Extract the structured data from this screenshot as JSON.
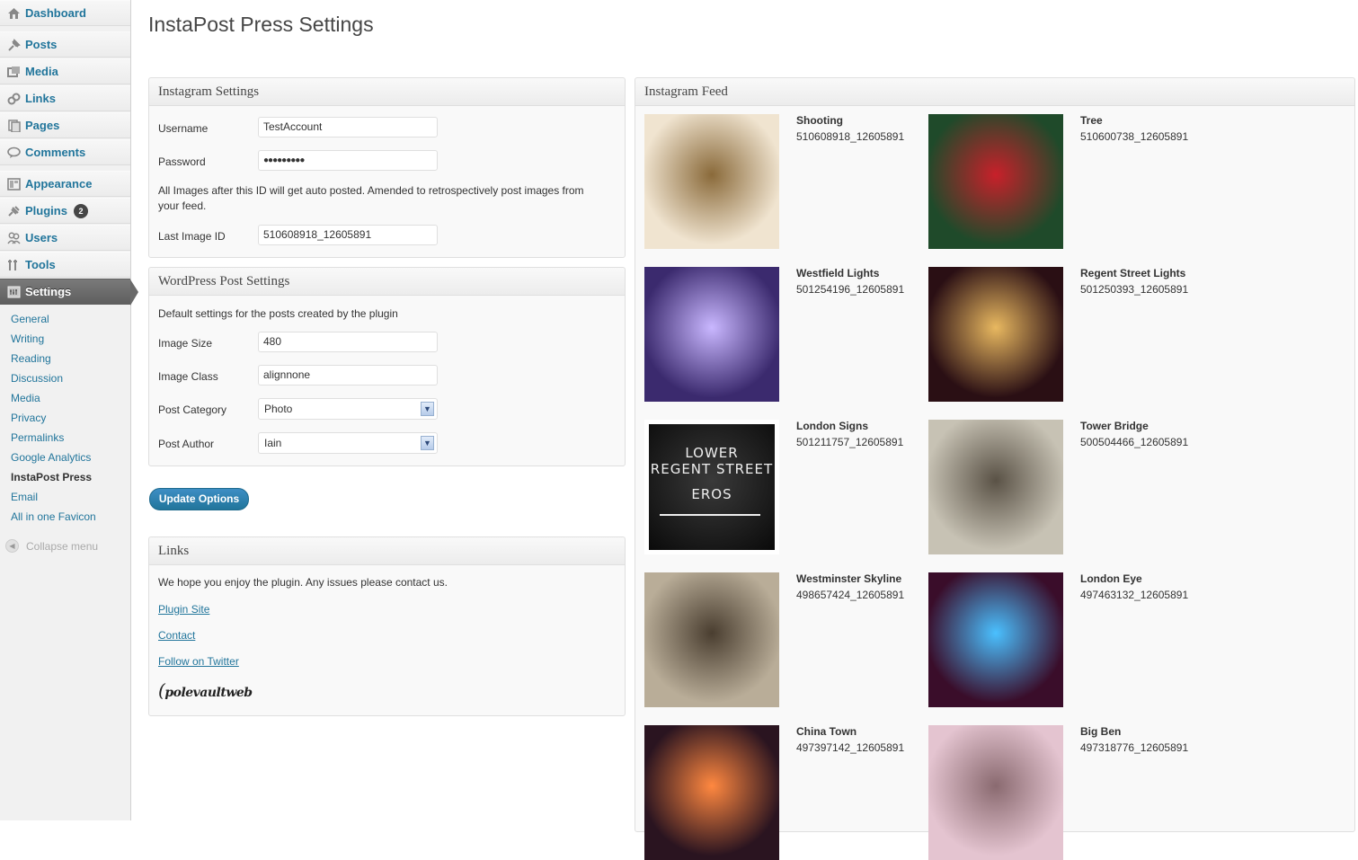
{
  "sidebar": {
    "menu": [
      {
        "label": "Dashboard",
        "icon": "dashboard-icon"
      },
      {
        "label": "Posts",
        "icon": "posts-pin-icon"
      },
      {
        "label": "Media",
        "icon": "media-icon"
      },
      {
        "label": "Links",
        "icon": "links-icon"
      },
      {
        "label": "Pages",
        "icon": "pages-icon"
      },
      {
        "label": "Comments",
        "icon": "comments-icon"
      },
      {
        "label": "Appearance",
        "icon": "appearance-icon"
      },
      {
        "label": "Plugins",
        "icon": "plugins-icon",
        "badge": "2"
      },
      {
        "label": "Users",
        "icon": "users-icon"
      },
      {
        "label": "Tools",
        "icon": "tools-icon"
      },
      {
        "label": "Settings",
        "icon": "settings-icon"
      }
    ],
    "submenu": [
      "General",
      "Writing",
      "Reading",
      "Discussion",
      "Media",
      "Privacy",
      "Permalinks",
      "Google Analytics",
      "InstaPost Press",
      "Email",
      "All in one Favicon"
    ],
    "collapse_label": "Collapse menu"
  },
  "page_title": "InstaPost Press Settings",
  "instagram_settings": {
    "heading": "Instagram Settings",
    "username_label": "Username",
    "username_value": "TestAccount",
    "password_label": "Password",
    "password_value": "●●●●●●●●●",
    "description": "All Images after this ID will get auto posted. Amended to retrospectively post images from your feed.",
    "last_image_label": "Last Image ID",
    "last_image_value": "510608918_12605891"
  },
  "wp_post_settings": {
    "heading": "WordPress Post Settings",
    "description": "Default settings for the posts created by the plugin",
    "image_size_label": "Image Size",
    "image_size_value": "480",
    "image_class_label": "Image Class",
    "image_class_value": "alignnone",
    "post_category_label": "Post Category",
    "post_category_value": "Photo",
    "post_author_label": "Post Author",
    "post_author_value": "Iain"
  },
  "update_button": "Update Options",
  "links_box": {
    "heading": "Links",
    "text": "We hope you enjoy the plugin. Any issues please contact us.",
    "plugin_site": "Plugin Site",
    "contact": "Contact",
    "twitter": "Follow on Twitter",
    "logo_text": "polevaultweb"
  },
  "feed": {
    "heading": "Instagram Feed",
    "items": [
      {
        "title": "Shooting",
        "id": "510608918_12605891",
        "palette": "#f0e4d0",
        "accent": "#8a6a3a"
      },
      {
        "title": "Tree",
        "id": "510600738_12605891",
        "palette": "#1f4a2a",
        "accent": "#c8202a"
      },
      {
        "title": "Westfield Lights",
        "id": "501254196_12605891",
        "palette": "#3b2a6e",
        "accent": "#c9b7ff"
      },
      {
        "title": "Regent Street Lights",
        "id": "501250393_12605891",
        "palette": "#2a0f14",
        "accent": "#e8b860"
      },
      {
        "title": "London Signs",
        "id": "501211757_12605891",
        "palette": "#151515",
        "accent": "#ffffff",
        "sign_lines": [
          "LOWER",
          "REGENT STREET",
          "EROS"
        ]
      },
      {
        "title": "Tower Bridge",
        "id": "500504466_12605891",
        "palette": "#c7c2b4",
        "accent": "#5a5246"
      },
      {
        "title": "Westminster Skyline",
        "id": "498657424_12605891",
        "palette": "#b9ad98",
        "accent": "#4a3e30"
      },
      {
        "title": "London Eye",
        "id": "497463132_12605891",
        "palette": "#3a0d2a",
        "accent": "#4ac0ff"
      },
      {
        "title": "China Town",
        "id": "497397142_12605891",
        "palette": "#2a1420",
        "accent": "#ff8840"
      },
      {
        "title": "Big Ben",
        "id": "497318776_12605891",
        "palette": "#e4c4d0",
        "accent": "#8a6a70"
      }
    ]
  }
}
